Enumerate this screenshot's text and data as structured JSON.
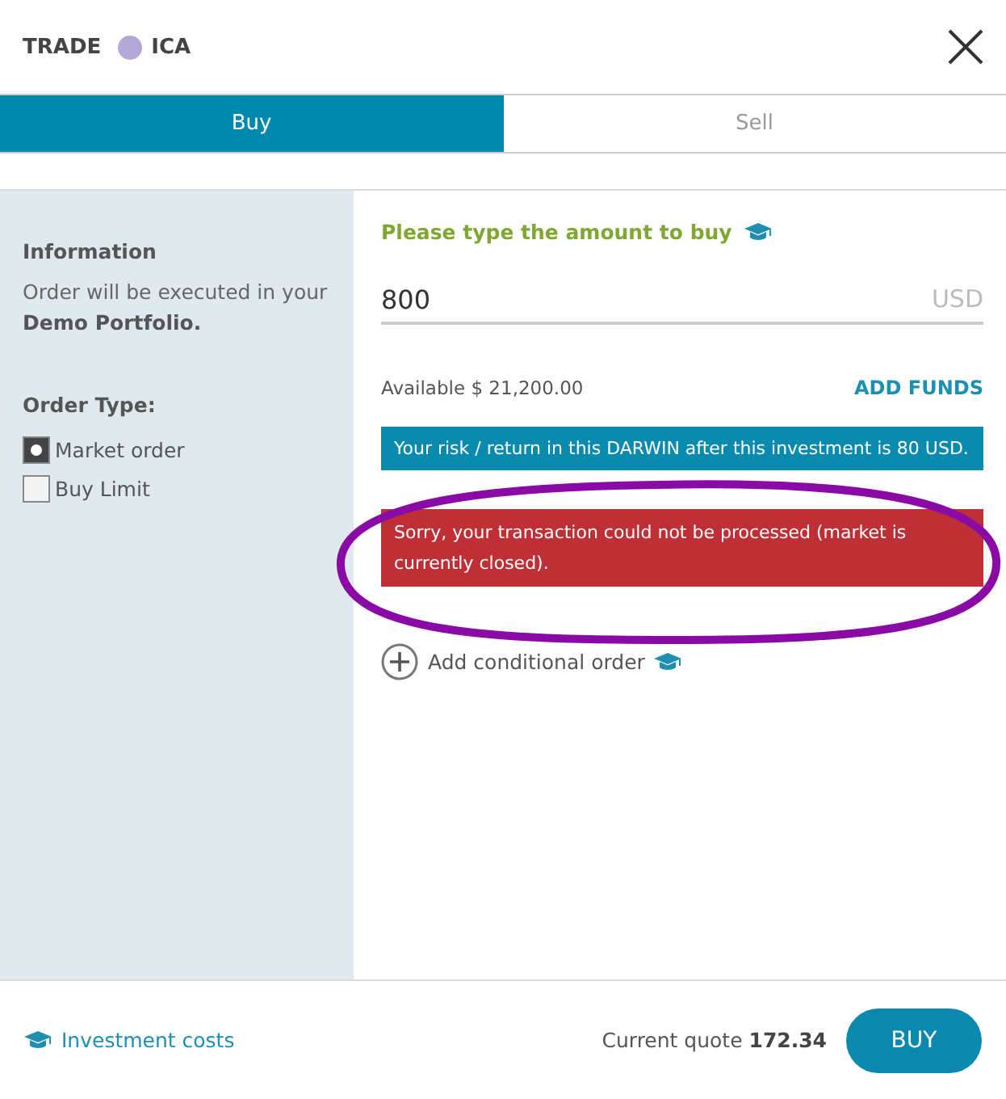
{
  "header": {
    "title": "TRADE",
    "asset": "ICA"
  },
  "tabs": [
    {
      "label": "Buy",
      "selected": true
    },
    {
      "label": "Sell",
      "selected": false
    }
  ],
  "info": {
    "heading": "Information",
    "text": "Order will be executed in your **Demo Portfolio.**"
  },
  "order_type": {
    "label": "Order Type:",
    "options": [
      {
        "label": "Market order",
        "selected": true
      },
      {
        "label": "Buy Limit",
        "selected": false
      }
    ]
  },
  "amount": {
    "prompt": "Please type the amount to buy",
    "value": "800",
    "currency": "USD"
  },
  "available": "Available $ 21,200.00",
  "add_funds": "ADD FUNDS",
  "risk_notice": "Your risk / return in this DARWIN after this investment is 80 USD.",
  "error": "Sorry, your transaction could not be processed (market is currently closed).",
  "conditional": "Add conditional order",
  "footer": {
    "costs": "Investment costs",
    "quote": "Current quote **172.34**",
    "buy": "BUY"
  }
}
